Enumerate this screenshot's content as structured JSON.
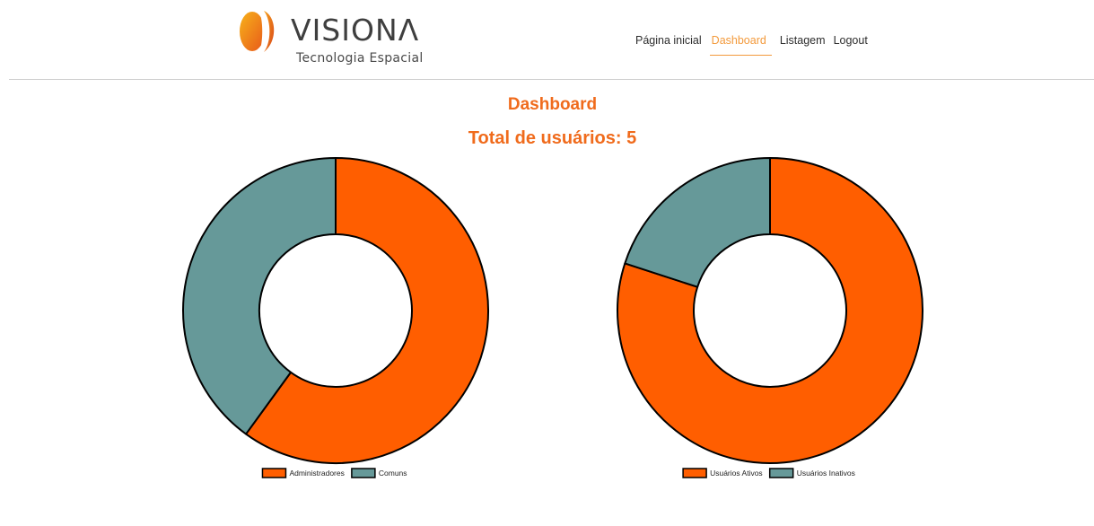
{
  "brand": {
    "name": "VISIONΛ",
    "tagline": "Tecnologia Espacial"
  },
  "nav": {
    "items": [
      {
        "label": "Página inicial"
      },
      {
        "label": "Dashboard"
      },
      {
        "label": "Listagem"
      },
      {
        "label": "Logout"
      }
    ],
    "active_index": 1
  },
  "page": {
    "title": "Dashboard",
    "subtitle": "Total de usuários: 5"
  },
  "colors": {
    "accent": "#f06b1c",
    "orange_slice": "#ff5e00",
    "teal_slice": "#669999",
    "nav_active": "#f39a3c"
  },
  "chart_data": [
    {
      "type": "pie",
      "donut": true,
      "categories": [
        "Administradores",
        "Comuns"
      ],
      "values": [
        3,
        2
      ],
      "colors": [
        "#ff5e00",
        "#669999"
      ],
      "legend": "bottom"
    },
    {
      "type": "pie",
      "donut": true,
      "categories": [
        "Usuários Ativos",
        "Usuários Inativos"
      ],
      "values": [
        4,
        1
      ],
      "colors": [
        "#ff5e00",
        "#669999"
      ],
      "legend": "bottom"
    }
  ]
}
